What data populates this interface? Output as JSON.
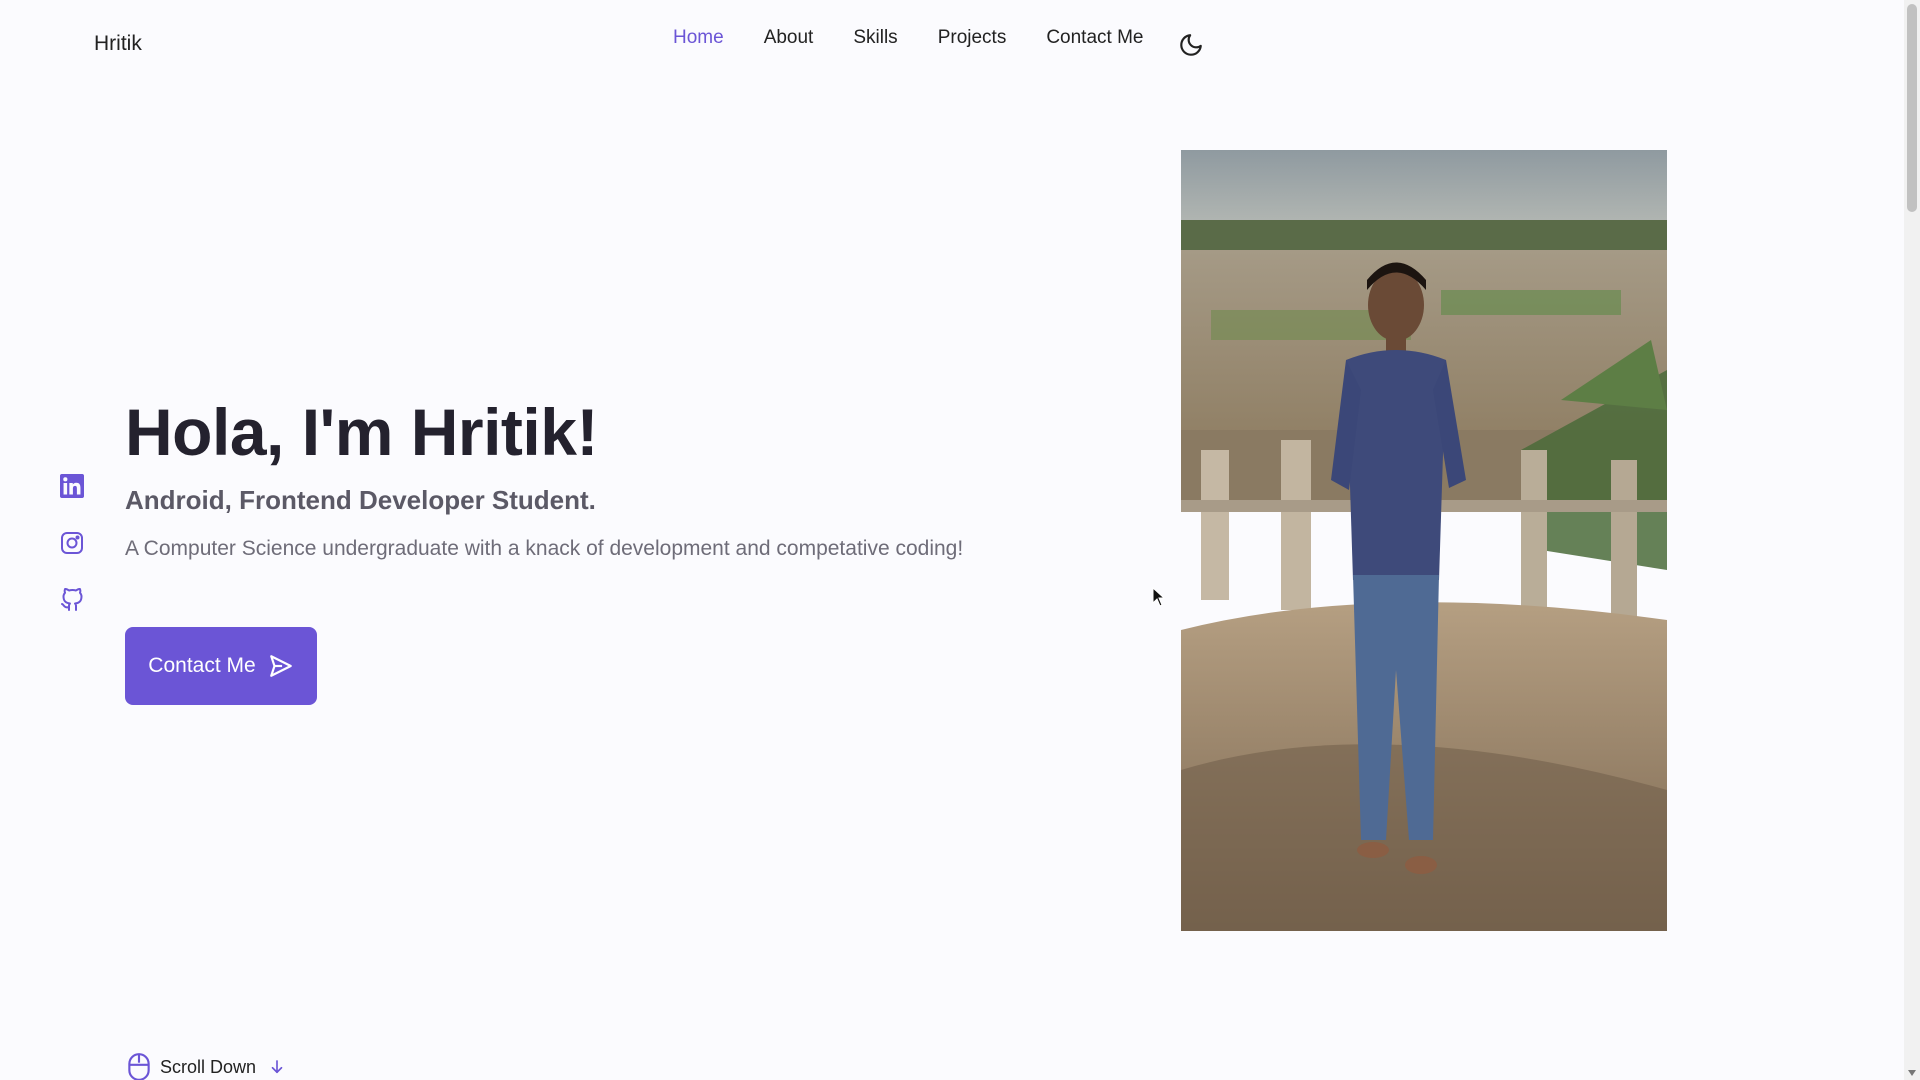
{
  "header": {
    "logo": "Hritik",
    "nav": [
      {
        "label": "Home",
        "active": true
      },
      {
        "label": "About"
      },
      {
        "label": "Skills"
      },
      {
        "label": "Projects"
      },
      {
        "label": "Contact Me"
      }
    ],
    "theme_icon": "moon-icon"
  },
  "social": [
    "linkedin-icon",
    "instagram-icon",
    "github-icon"
  ],
  "hero": {
    "title": "Hola, I'm Hritik!",
    "subtitle": "Android, Frontend Developer Student.",
    "description": "A Computer Science undergraduate with a knack of development and competative coding!",
    "button_label": "Contact Me",
    "button_icon": "send-icon"
  },
  "scroll_down": {
    "label": "Scroll Down",
    "icon": "mouse-icon"
  },
  "colors": {
    "accent": "#6b55d6",
    "background": "#fbfbfe",
    "title": "#24222e"
  }
}
